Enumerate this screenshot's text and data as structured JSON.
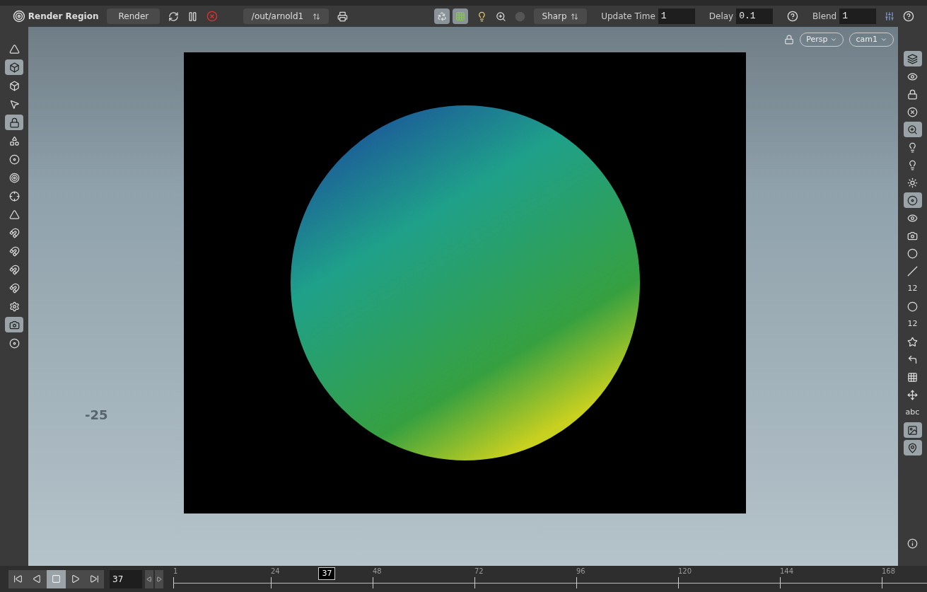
{
  "toolbar": {
    "title": "Render Region",
    "render_button": "Render",
    "render_path": "/out/arnold1",
    "toggles": [
      {
        "selected": true
      },
      {
        "selected": true
      }
    ],
    "filter": "Sharp",
    "update_time": {
      "label": "Update Time",
      "value": "1"
    },
    "delay": {
      "label": "Delay",
      "value": "0.1"
    },
    "blend": {
      "label": "Blend",
      "value": "1"
    }
  },
  "viewport": {
    "view_menu": "Persp",
    "camera_menu": "cam1",
    "grid_label": "-25"
  },
  "left_tools": [
    {
      "selected": false
    },
    {
      "selected": true
    },
    {
      "selected": false
    },
    {
      "selected": false
    },
    {
      "selected": true
    },
    {
      "selected": false
    },
    {
      "selected": false
    },
    {
      "selected": false
    },
    {
      "selected": false
    },
    {
      "selected": false
    },
    {
      "selected": false
    },
    {
      "selected": false
    },
    {
      "selected": false
    },
    {
      "selected": false
    },
    {
      "selected": false
    },
    {
      "selected": true
    },
    {
      "selected": false
    }
  ],
  "right_tools": [
    {
      "selected": true
    },
    {
      "selected": false
    },
    {
      "selected": false
    },
    {
      "selected": false
    },
    {
      "selected": true
    },
    {
      "selected": false
    },
    {
      "selected": false
    },
    {
      "selected": false
    },
    {
      "selected": true
    },
    {
      "selected": false
    },
    {
      "selected": false
    },
    {
      "selected": false
    },
    {
      "selected": false
    },
    {
      "selected": false,
      "label": "12"
    },
    {
      "selected": false
    },
    {
      "selected": false,
      "label": "12"
    },
    {
      "selected": false
    },
    {
      "selected": false
    },
    {
      "selected": false
    },
    {
      "selected": false
    },
    {
      "selected": false,
      "label": "abc"
    },
    {
      "selected": true
    },
    {
      "selected": true
    }
  ],
  "timeline": {
    "frame": "37",
    "playhead_label": "37",
    "level": 0.204,
    "ticks": [
      "1",
      "24",
      "48",
      "72",
      "96",
      "120",
      "144",
      "168"
    ]
  }
}
